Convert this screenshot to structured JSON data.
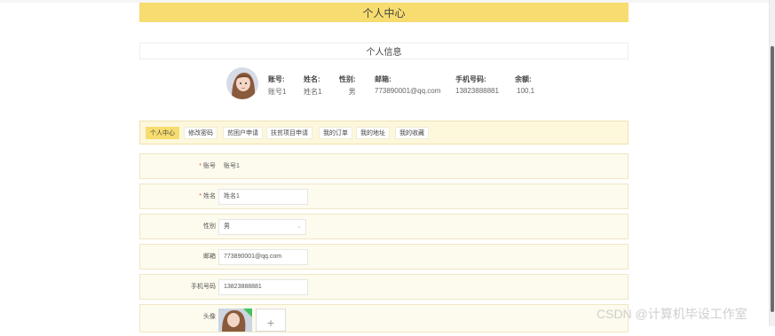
{
  "page": {
    "title": "个人中心"
  },
  "profile": {
    "section_title": "个人信息",
    "fields": [
      {
        "label": "账号:",
        "value": "账号1"
      },
      {
        "label": "姓名:",
        "value": "姓名1"
      },
      {
        "label": "性别:",
        "value": "男"
      },
      {
        "label": "邮箱:",
        "value": "773890001@qq.com"
      },
      {
        "label": "手机号码:",
        "value": "13823888881"
      },
      {
        "label": "余额:",
        "value": "100.1"
      }
    ]
  },
  "tabs": [
    {
      "label": "个人中心",
      "active": true
    },
    {
      "label": "修改密码",
      "active": false
    },
    {
      "label": "贫困户申请",
      "active": false
    },
    {
      "label": "扶贫项目申请",
      "active": false
    },
    {
      "label": "我的订单",
      "active": false
    },
    {
      "label": "我的地址",
      "active": false
    },
    {
      "label": "我的收藏",
      "active": false
    }
  ],
  "form": {
    "account": {
      "label": "账号",
      "value": "账号1",
      "required": "*"
    },
    "name": {
      "label": "姓名",
      "value": "姓名1",
      "required": "*"
    },
    "gender": {
      "label": "性别",
      "value": "男"
    },
    "email": {
      "label": "邮箱",
      "value": "773890001@qq.com"
    },
    "phone": {
      "label": "手机号码",
      "value": "13823888881"
    },
    "avatar": {
      "label": "头像",
      "add_symbol": "+"
    }
  },
  "watermark": "CSDN @计算机毕设工作室",
  "colors": {
    "accent": "#f7dc6f",
    "row_bg": "#fdfbee",
    "tab_bar_bg": "#fdf7dc",
    "required": "#e05050"
  },
  "icons": {
    "dropdown": "chevron-down-icon",
    "upload": "plus-icon",
    "upload_ok": "check-badge-icon"
  }
}
